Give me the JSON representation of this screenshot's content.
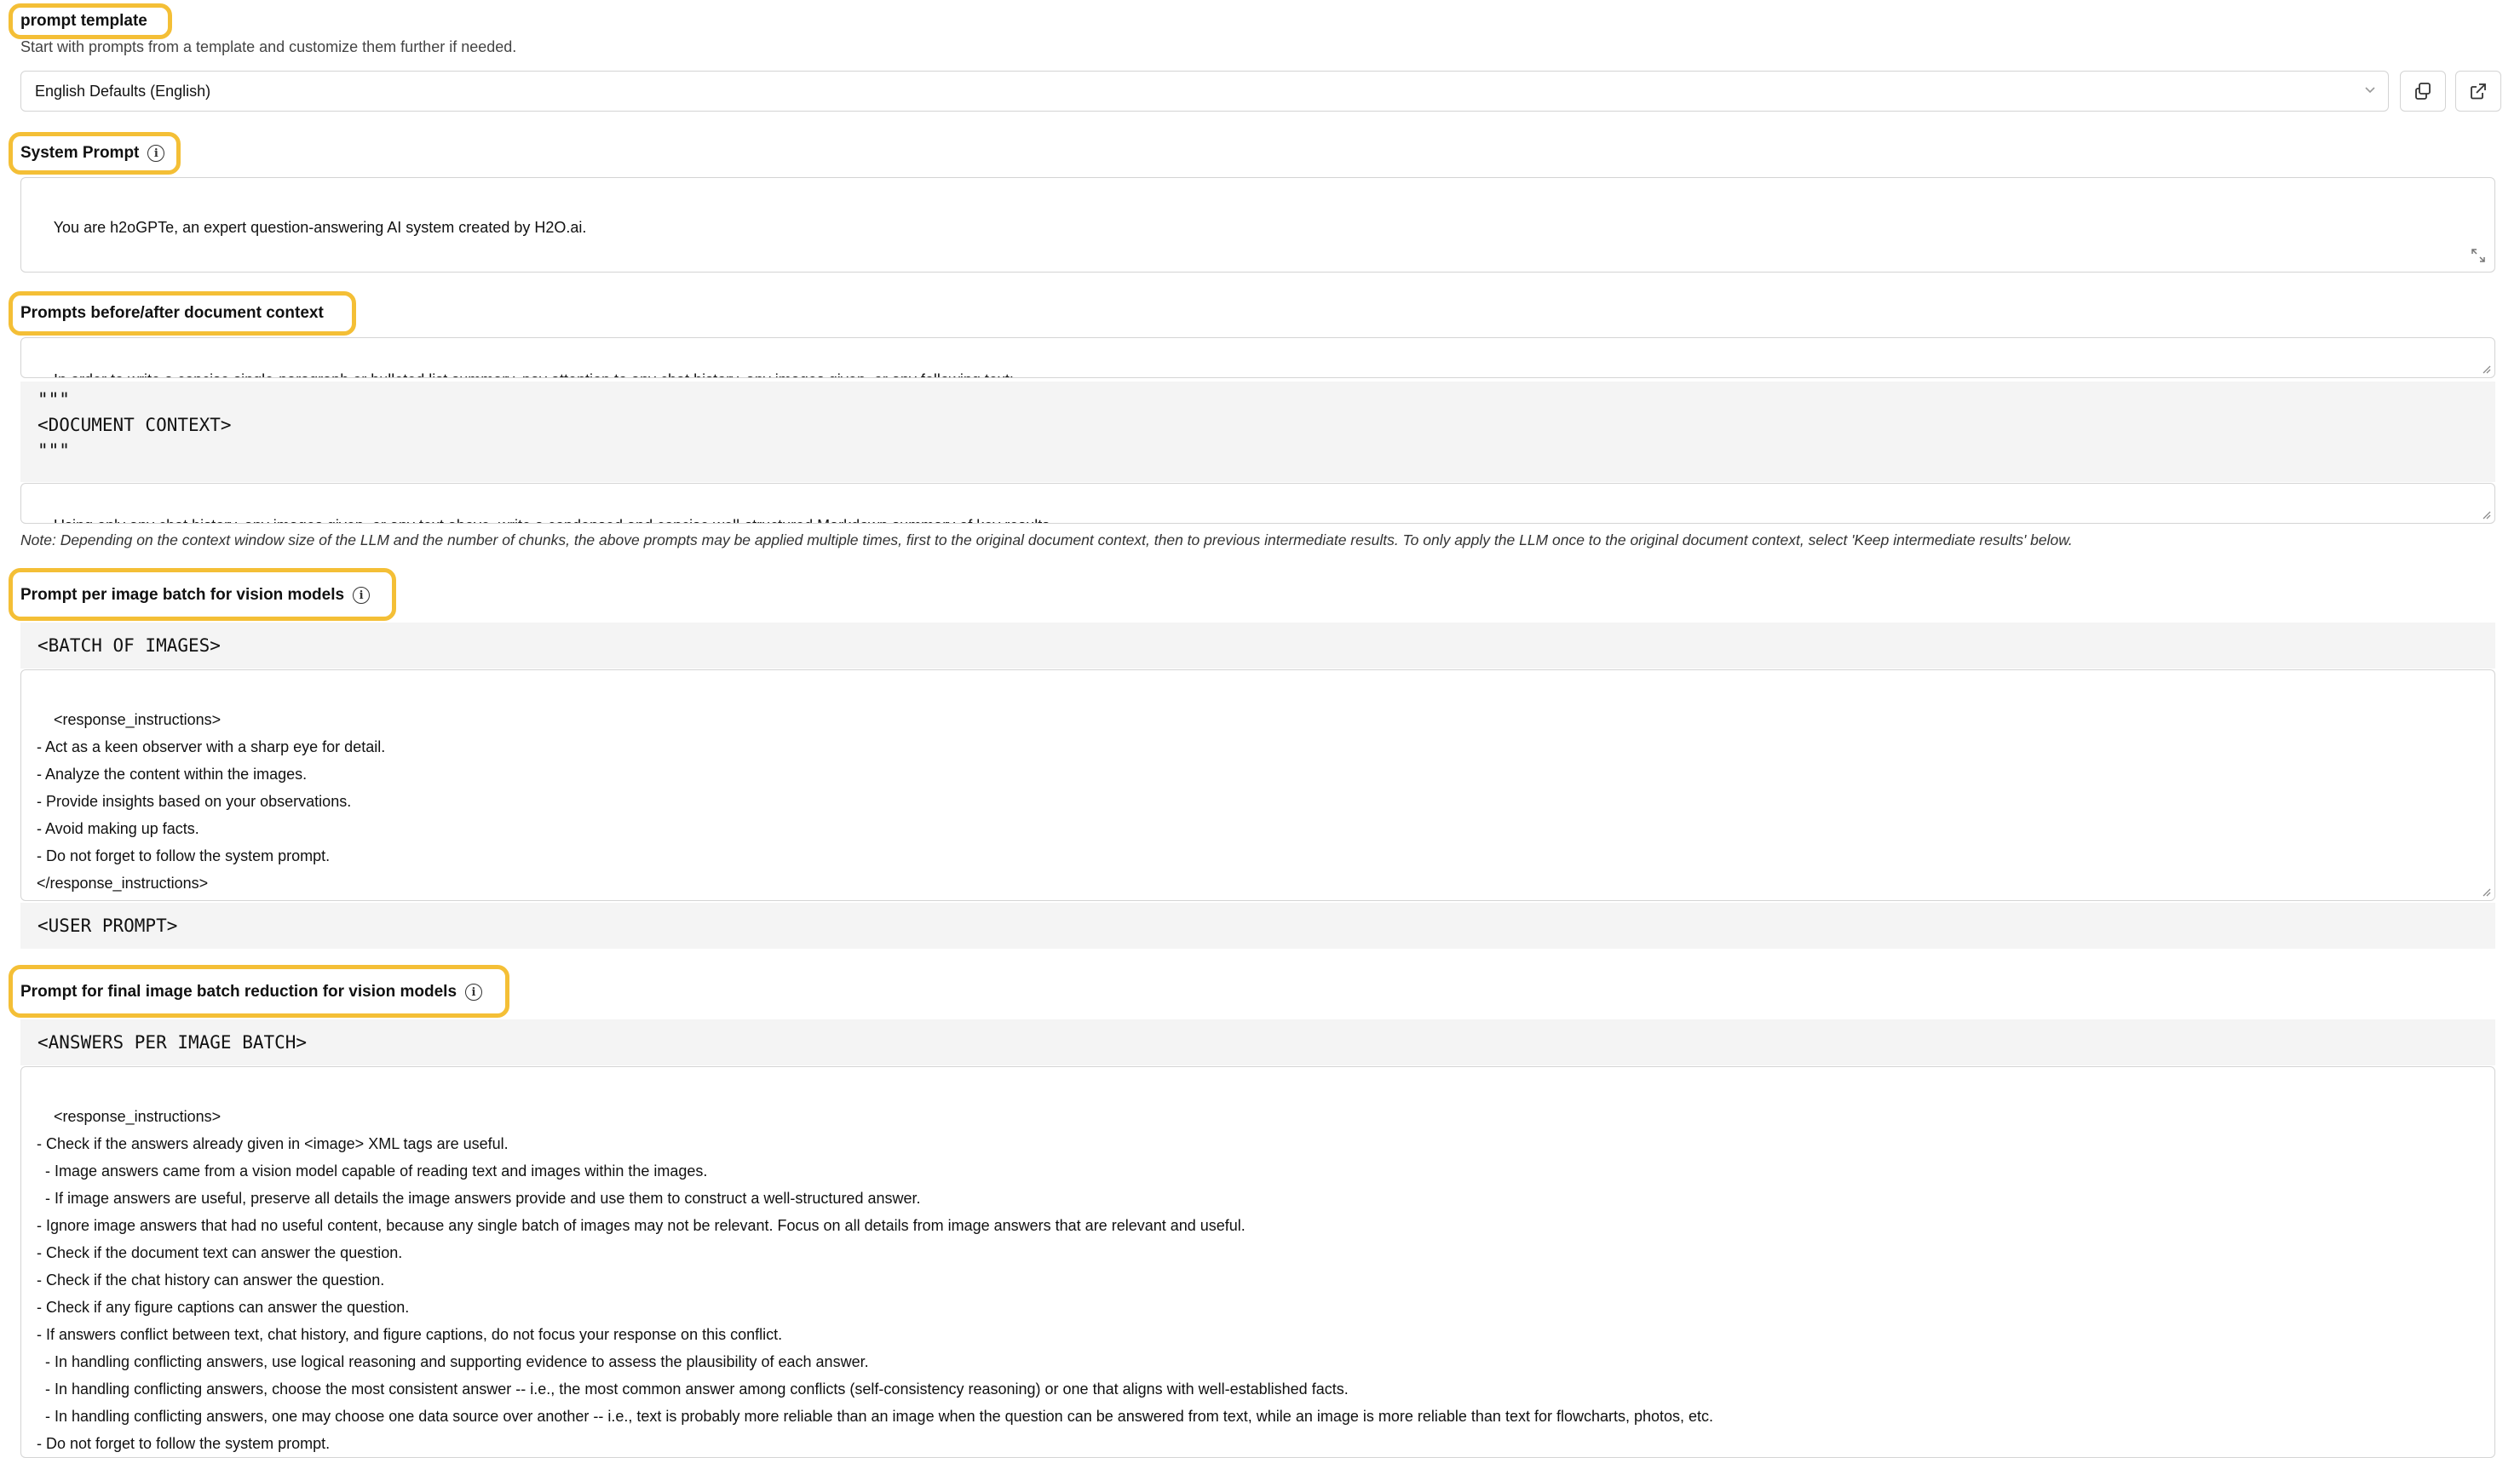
{
  "prompt_template": {
    "label": "prompt template",
    "subtitle": "Start with prompts from a template and customize them further if needed.",
    "selected": "English Defaults (English)"
  },
  "system_prompt": {
    "label": "System Prompt",
    "value": "You are h2oGPTe, an expert question-answering AI system created by H2O.ai."
  },
  "doc_context": {
    "label": "Prompts before/after document context",
    "before": "In order to write a concise single-paragraph or bulleted list summary, pay attention to any chat history, any images given, or any following text:",
    "context_block": "\"\"\"\n<DOCUMENT CONTEXT>\n\"\"\"",
    "after": "Using only any chat history, any images given, or any text above, write a condensed and concise well-structured Markdown summary of key results.",
    "note": "Note: Depending on the context window size of the LLM and the number of chunks, the above prompts may be applied multiple times, first to the original document context, then to previous intermediate results. To only apply the LLM once to the original document context, select 'Keep intermediate results' below."
  },
  "image_batch": {
    "label": "Prompt per image batch for vision models",
    "header_block": "<BATCH OF IMAGES>",
    "value": "<response_instructions>\n- Act as a keen observer with a sharp eye for detail.\n- Analyze the content within the images.\n- Provide insights based on your observations.\n- Avoid making up facts.\n- Do not forget to follow the system prompt.\n</response_instructions>",
    "footer_block": "<USER PROMPT>"
  },
  "image_reduction": {
    "label": "Prompt for final image batch reduction for vision models",
    "header_block": "<ANSWERS PER IMAGE BATCH>",
    "value": "<response_instructions>\n- Check if the answers already given in <image> XML tags are useful.\n  - Image answers came from a vision model capable of reading text and images within the images.\n  - If image answers are useful, preserve all details the image answers provide and use them to construct a well-structured answer.\n- Ignore image answers that had no useful content, because any single batch of images may not be relevant. Focus on all details from image answers that are relevant and useful.\n- Check if the document text can answer the question.\n- Check if the chat history can answer the question.\n- Check if any figure captions can answer the question.\n- If answers conflict between text, chat history, and figure captions, do not focus your response on this conflict.\n  - In handling conflicting answers, use logical reasoning and supporting evidence to assess the plausibility of each answer.\n  - In handling conflicting answers, choose the most consistent answer -- i.e., the most common answer among conflicts (self-consistency reasoning) or one that aligns with well-established facts.\n  - In handling conflicting answers, one may choose one data source over another -- i.e., text is probably more reliable than an image when the question can be answered from text, while an image is more reliable than text for flowcharts, photos, etc.\n- Do not forget to follow the system prompt.\n- Finally, according to our chat history, the above documents, figure captions, or given images, construct a well-structured response."
  },
  "colors": {
    "highlight": "#f4bf36",
    "border": "#d4d4d4",
    "code_bg": "#f4f4f4"
  },
  "icons": [
    "info-icon",
    "chevron-down-icon",
    "copy-icon",
    "external-link-icon",
    "expand-icon",
    "resize-handle-icon"
  ]
}
